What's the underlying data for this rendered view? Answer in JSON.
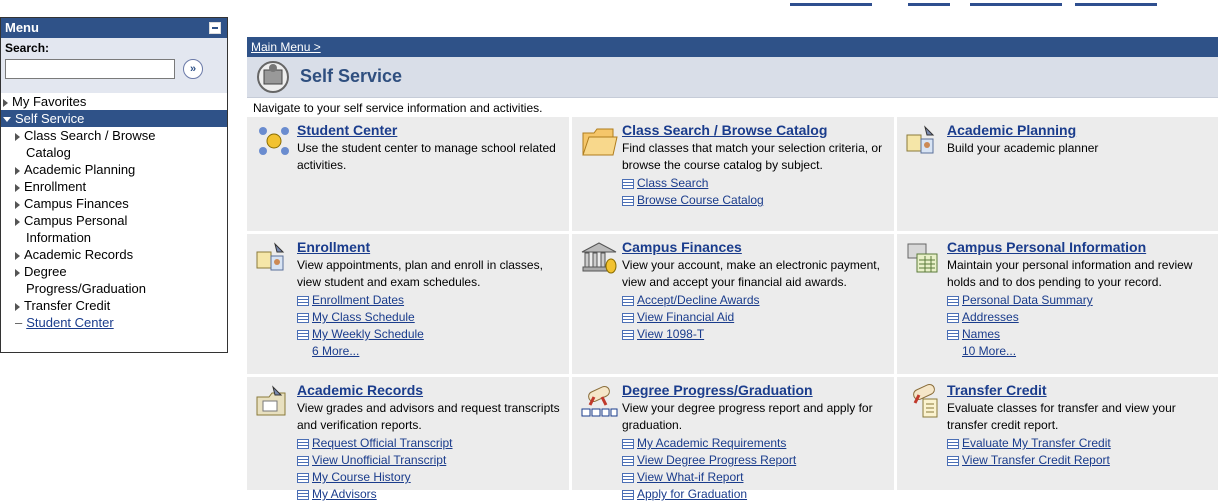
{
  "menu": {
    "title": "Menu",
    "search_label": "Search:",
    "search_value": "",
    "search_go_symbol": "»",
    "items": [
      {
        "label": "My Favorites"
      },
      {
        "label": "Self Service"
      }
    ],
    "sub_items": [
      {
        "line1": "Class Search / Browse",
        "line2": "Catalog"
      },
      {
        "line1": "Academic Planning",
        "line2": ""
      },
      {
        "line1": "Enrollment",
        "line2": ""
      },
      {
        "line1": "Campus Finances",
        "line2": ""
      },
      {
        "line1": "Campus Personal",
        "line2": "Information"
      },
      {
        "line1": "Academic Records",
        "line2": ""
      },
      {
        "line1": "Degree",
        "line2": "Progress/Graduation"
      },
      {
        "line1": "Transfer Credit",
        "line2": ""
      }
    ],
    "current_link": "Student Center"
  },
  "breadcrumb": "Main Menu >",
  "page_title": "Self Service",
  "subtitle": "Navigate to your self service information and activities.",
  "cards": [
    {
      "title": "Student Center",
      "desc": "Use the student center to manage school related activities.",
      "links": [],
      "more": ""
    },
    {
      "title": "Class Search / Browse Catalog",
      "desc": "Find classes that match your selection criteria, or browse the course catalog by subject.",
      "links": [
        "Class Search",
        "Browse Course Catalog"
      ],
      "more": ""
    },
    {
      "title": "Academic Planning",
      "desc": "Build your academic planner",
      "links": [],
      "more": ""
    },
    {
      "title": "Enrollment",
      "desc": "View appointments, plan and enroll in classes, view student and exam schedules.",
      "links": [
        "Enrollment Dates",
        "My Class Schedule",
        "My Weekly Schedule"
      ],
      "more": "6 More..."
    },
    {
      "title": "Campus Finances",
      "desc": "View your account, make an electronic payment, view and accept your financial aid awards.",
      "links": [
        "Accept/Decline Awards",
        "View Financial Aid",
        "View 1098-T"
      ],
      "more": ""
    },
    {
      "title": "Campus Personal Information",
      "desc": "Maintain your personal information and review holds and to dos pending to your record.",
      "links": [
        "Personal Data Summary",
        "Addresses",
        "Names"
      ],
      "more": "10 More..."
    },
    {
      "title": "Academic Records",
      "desc": "View grades and advisors and request transcripts and verification reports.",
      "links": [
        "Request Official Transcript",
        "View Unofficial Transcript",
        "My Course History",
        "My Advisors"
      ],
      "more": ""
    },
    {
      "title": "Degree Progress/Graduation",
      "desc": "View your degree progress report and apply for graduation.",
      "links": [
        "My Academic Requirements",
        "View Degree Progress Report",
        "View What-if Report",
        "Apply for Graduation"
      ],
      "more": ""
    },
    {
      "title": "Transfer Credit",
      "desc": "Evaluate classes for transfer and view your transfer credit report.",
      "links": [
        "Evaluate My Transfer Credit",
        "View Transfer Credit Report"
      ],
      "more": ""
    }
  ],
  "colors": {
    "accent": "#2f5288",
    "link": "#1a3c8c",
    "card_bg": "#ececec"
  }
}
